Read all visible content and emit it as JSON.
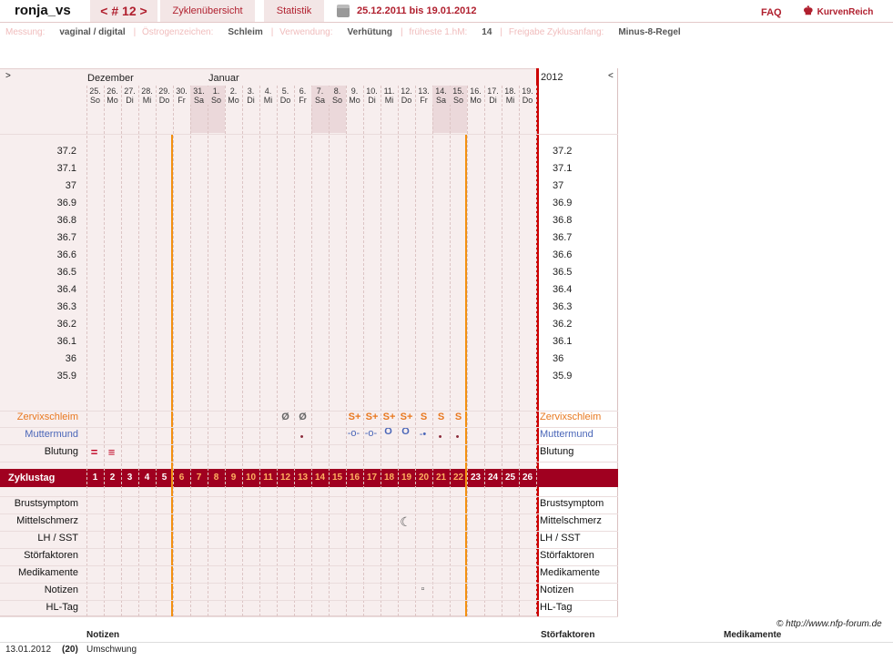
{
  "header": {
    "user": "ronja_vs",
    "cycle_nav": "< # 12 >",
    "tab_cycles": "Zyklenübersicht",
    "tab_stats": "Statistik",
    "date_range": "25.12.2011 bis 19.01.2012",
    "faq": "FAQ",
    "logo_text": "KurvenReich"
  },
  "info": {
    "messung_label": "Messung:",
    "messung_value": "vaginal / digital",
    "oestro_label": "Östrogenzeichen:",
    "oestro_value": "Schleim",
    "verw_label": "Verwendung:",
    "verw_value": "Verhütung",
    "hm_label": "früheste 1.hM:",
    "hm_value": "14",
    "freigabe_label": "Freigabe Zyklusanfang:",
    "freigabe_value": "Minus-8-Regel"
  },
  "chart": {
    "nav_left": ">",
    "nav_right": "<",
    "month_dec": "Dezember",
    "month_jan": "Januar",
    "year": "2012",
    "days": [
      {
        "d": "25.",
        "w": "So"
      },
      {
        "d": "26.",
        "w": "Mo"
      },
      {
        "d": "27.",
        "w": "Di"
      },
      {
        "d": "28.",
        "w": "Mi"
      },
      {
        "d": "29.",
        "w": "Do"
      },
      {
        "d": "30.",
        "w": "Fr"
      },
      {
        "d": "31.",
        "w": "Sa"
      },
      {
        "d": "1.",
        "w": "So"
      },
      {
        "d": "2.",
        "w": "Mo"
      },
      {
        "d": "3.",
        "w": "Di"
      },
      {
        "d": "4.",
        "w": "Mi"
      },
      {
        "d": "5.",
        "w": "Do"
      },
      {
        "d": "6.",
        "w": "Fr"
      },
      {
        "d": "7.",
        "w": "Sa"
      },
      {
        "d": "8.",
        "w": "So"
      },
      {
        "d": "9.",
        "w": "Mo"
      },
      {
        "d": "10.",
        "w": "Di"
      },
      {
        "d": "11.",
        "w": "Mi"
      },
      {
        "d": "12.",
        "w": "Do"
      },
      {
        "d": "13.",
        "w": "Fr"
      },
      {
        "d": "14.",
        "w": "Sa"
      },
      {
        "d": "15.",
        "w": "So"
      },
      {
        "d": "16.",
        "w": "Mo"
      },
      {
        "d": "17.",
        "w": "Di"
      },
      {
        "d": "18.",
        "w": "Mi"
      },
      {
        "d": "19.",
        "w": "Do"
      }
    ],
    "temps": [
      "37.2",
      "37.1",
      "37",
      "36.9",
      "36.8",
      "36.7",
      "36.6",
      "36.5",
      "36.4",
      "36.3",
      "36.2",
      "36.1",
      "36",
      "35.9"
    ],
    "labels": {
      "zervix": "Zervixschleim",
      "mutter": "Muttermund",
      "blutung": "Blutung",
      "zyklustag": "Zyklustag",
      "brust": "Brustsymptom",
      "mittel": "Mittelschmerz",
      "lh": "LH / SST",
      "stoer": "Störfaktoren",
      "medi": "Medikamente",
      "notizen": "Notizen",
      "hl": "HL-Tag"
    },
    "zervix_symbols": [
      "",
      "",
      "",
      "",
      "",
      "",
      "",
      "",
      "",
      "",
      "",
      "Ø",
      "Ø",
      "",
      "",
      "S+",
      "S+",
      "S+",
      "S+",
      "S",
      "S",
      "S",
      "",
      "",
      "",
      ""
    ],
    "cycle_days": [
      "1",
      "2",
      "3",
      "4",
      "5",
      "6",
      "7",
      "8",
      "9",
      "10",
      "11",
      "12",
      "13",
      "14",
      "15",
      "16",
      "17",
      "18",
      "19",
      "20",
      "21",
      "22",
      "23",
      "24",
      "25",
      "26"
    ]
  },
  "footer": {
    "copyright": "© http://www.nfp-forum.de",
    "h_notizen": "Notizen",
    "h_stoer": "Störfaktoren",
    "h_medi": "Medikamente",
    "row_date": "13.01.2012",
    "row_day": "(20)",
    "row_note": "Umschwung"
  },
  "colors": {
    "accent": "#b01f2e",
    "zyklustag_bar": "#a00020",
    "coverline": "#f29010",
    "right_border": "#cc0000"
  }
}
